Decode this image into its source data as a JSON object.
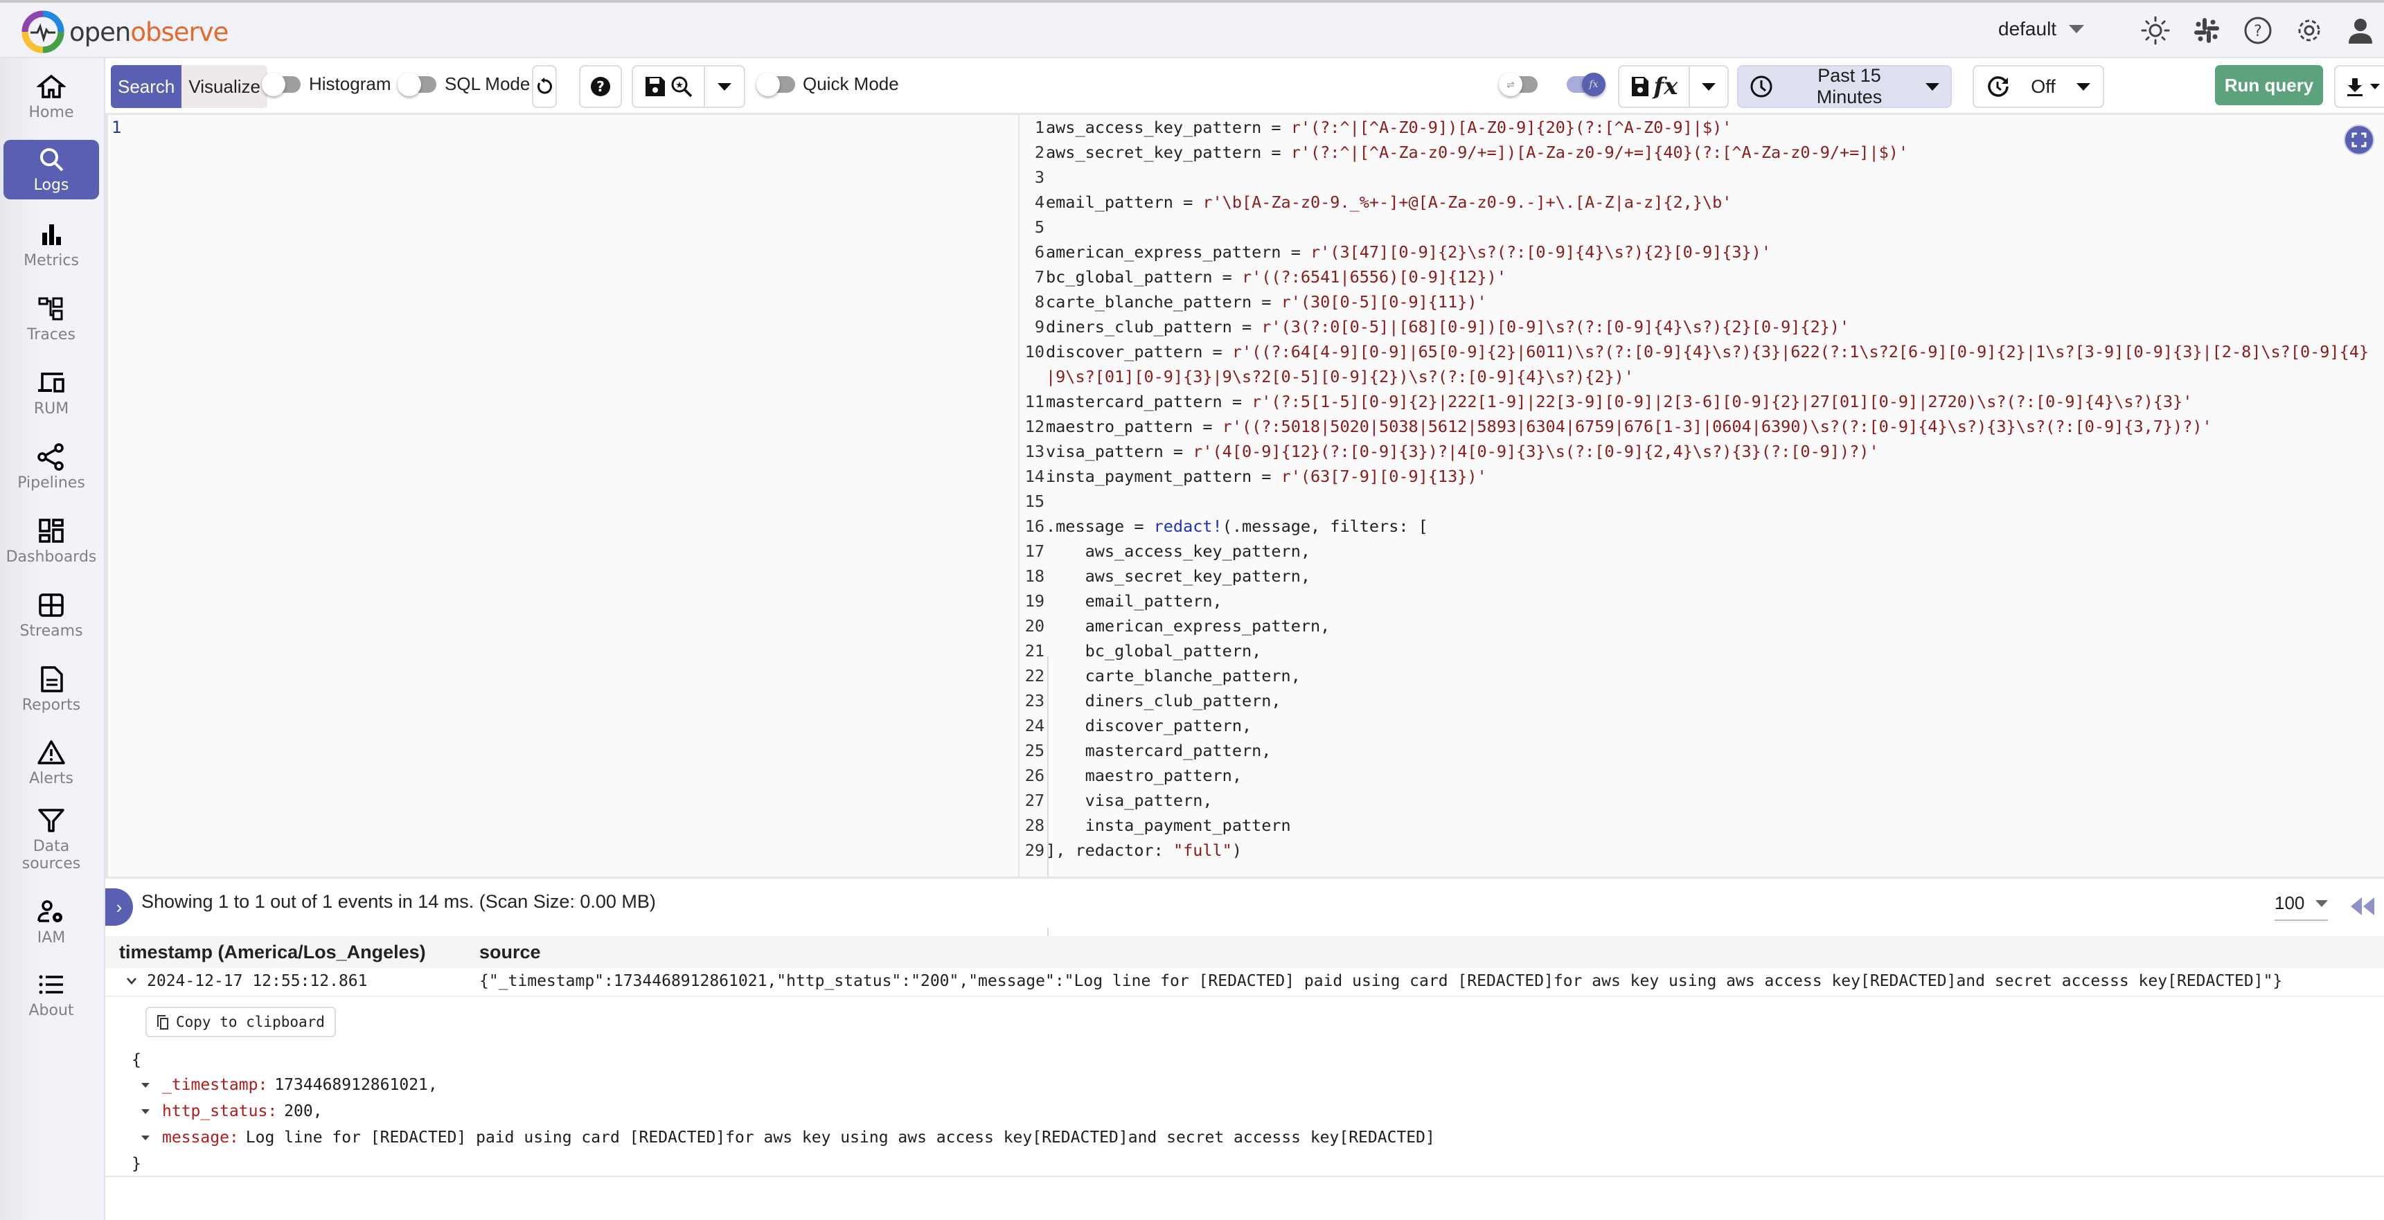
{
  "header": {
    "logo_part1": "open",
    "logo_part2": "observe",
    "org_selector": "default",
    "icons": [
      "theme-toggle-icon",
      "slack-icon",
      "help-icon",
      "settings-icon",
      "user-icon"
    ]
  },
  "sidebar": {
    "items": [
      {
        "label": "Home",
        "icon": "home-icon",
        "active": false
      },
      {
        "label": "Logs",
        "icon": "search-icon",
        "active": true
      },
      {
        "label": "Metrics",
        "icon": "bar-chart-icon",
        "active": false
      },
      {
        "label": "Traces",
        "icon": "traces-icon",
        "active": false
      },
      {
        "label": "RUM",
        "icon": "devices-icon",
        "active": false
      },
      {
        "label": "Pipelines",
        "icon": "share-nodes-icon",
        "active": false
      },
      {
        "label": "Dashboards",
        "icon": "dashboard-icon",
        "active": false
      },
      {
        "label": "Streams",
        "icon": "grid-icon",
        "active": false
      },
      {
        "label": "Reports",
        "icon": "document-icon",
        "active": false
      },
      {
        "label": "Alerts",
        "icon": "warning-icon",
        "active": false
      },
      {
        "label": "Data sources",
        "icon": "filter-icon",
        "active": false
      },
      {
        "label": "IAM",
        "icon": "user-settings-icon",
        "active": false
      },
      {
        "label": "About",
        "icon": "list-icon",
        "active": false
      }
    ]
  },
  "toolbar": {
    "search_tab": "Search",
    "visualize_tab": "Visualize",
    "histogram_label": "Histogram",
    "histogram_on": false,
    "sql_mode_label": "SQL Mode",
    "sql_mode_on": false,
    "quick_mode_label": "Quick Mode",
    "quick_mode_on": false,
    "wrap_toggle_on": false,
    "fx_toggle_on": true,
    "fx_label": "fx",
    "time_range": "Past 15 Minutes",
    "refresh_interval": "Off",
    "run_query_label": "Run query"
  },
  "query_editor": {
    "line_numbers": [
      "1"
    ],
    "content": ""
  },
  "vrl_editor": {
    "lines": [
      {
        "n": "1",
        "text": "aws_access_key_pattern = ",
        "str": "r'(?:^|[^A-Z0-9])[A-Z0-9]{20}(?:[^A-Z0-9]|$)'"
      },
      {
        "n": "2",
        "text": "aws_secret_key_pattern = ",
        "str": "r'(?:^|[^A-Za-z0-9/+=])[A-Za-z0-9/+=]{40}(?:[^A-Za-z0-9/+=]|$)'"
      },
      {
        "n": "3",
        "text": "",
        "str": ""
      },
      {
        "n": "4",
        "text": "email_pattern = ",
        "str": "r'\\b[A-Za-z0-9._%+-]+@[A-Za-z0-9.-]+\\.[A-Z|a-z]{2,}\\b'"
      },
      {
        "n": "5",
        "text": "",
        "str": ""
      },
      {
        "n": "6",
        "text": "american_express_pattern = ",
        "str": "r'(3[47][0-9]{2}\\s?(?:[0-9]{4}\\s?){2}[0-9]{3})'"
      },
      {
        "n": "7",
        "text": "bc_global_pattern = ",
        "str": "r'((?:6541|6556)[0-9]{12})'"
      },
      {
        "n": "8",
        "text": "carte_blanche_pattern = ",
        "str": "r'(30[0-5][0-9]{11})'"
      },
      {
        "n": "9",
        "text": "diners_club_pattern = ",
        "str": "r'(3(?:0[0-5]|[68][0-9])[0-9]\\s?(?:[0-9]{4}\\s?){2}[0-9]{2})'"
      },
      {
        "n": "10",
        "text": "discover_pattern = ",
        "str": "r'((?:64[4-9][0-9]|65[0-9]{2}|6011)\\s?(?:[0-9]{4}\\s?){3}|622(?:1\\s?2[6-9][0-9]{2}|1\\s?[3-9][0-9]{3}|[2-8]\\s?[0-9]{4}|9\\s?[01][0-9]{3}|9\\s?2[0-5][0-9]{2})\\s?(?:[0-9]{4}\\s?){2})'"
      },
      {
        "n": "11",
        "text": "mastercard_pattern = ",
        "str": "r'(?:5[1-5][0-9]{2}|222[1-9]|22[3-9][0-9]|2[3-6][0-9]{2}|27[01][0-9]|2720)\\s?(?:[0-9]{4}\\s?){3}'"
      },
      {
        "n": "12",
        "text": "maestro_pattern = ",
        "str": "r'((?:5018|5020|5038|5612|5893|6304|6759|676[1-3]|0604|6390)\\s?(?:[0-9]{4}\\s?){3}\\s?(?:[0-9]{3,7})?)'"
      },
      {
        "n": "13",
        "text": "visa_pattern = ",
        "str": "r'(4[0-9]{12}(?:[0-9]{3})?|4[0-9]{3}\\s(?:[0-9]{2,4}\\s?){3}(?:[0-9])?)'"
      },
      {
        "n": "14",
        "text": "insta_payment_pattern = ",
        "str": "r'(63[7-9][0-9]{13})'"
      },
      {
        "n": "15",
        "text": "",
        "str": ""
      },
      {
        "n": "16",
        "text": ".message = ",
        "fn": "redact!",
        "rest": "(.message, filters: ["
      },
      {
        "n": "17",
        "text": "    aws_access_key_pattern,"
      },
      {
        "n": "18",
        "text": "    aws_secret_key_pattern,"
      },
      {
        "n": "19",
        "text": "    email_pattern,"
      },
      {
        "n": "20",
        "text": "    american_express_pattern,"
      },
      {
        "n": "21",
        "text": "    bc_global_pattern,"
      },
      {
        "n": "22",
        "text": "    carte_blanche_pattern,"
      },
      {
        "n": "23",
        "text": "    diners_club_pattern,"
      },
      {
        "n": "24",
        "text": "    discover_pattern,"
      },
      {
        "n": "25",
        "text": "    mastercard_pattern,"
      },
      {
        "n": "26",
        "text": "    maestro_pattern,"
      },
      {
        "n": "27",
        "text": "    visa_pattern,"
      },
      {
        "n": "28",
        "text": "    insta_payment_pattern"
      },
      {
        "n": "29",
        "text": "], redactor: ",
        "str": "\"full\"",
        "rest": ")"
      }
    ]
  },
  "results": {
    "summary": "Showing 1 to 1 out of 1 events in 14 ms. (Scan Size: 0.00 MB)",
    "per_page": "100",
    "current_page": "1",
    "columns": [
      "timestamp (America/Los_Angeles)",
      "source"
    ],
    "rows": [
      {
        "timestamp": "2024-12-17 12:55:12.861",
        "source": "{\"_timestamp\":1734468912861021,\"http_status\":\"200\",\"message\":\"Log line for [REDACTED] paid using card [REDACTED]for aws key using aws access key[REDACTED]and secret accesss key[REDACTED]\"}"
      }
    ],
    "expanded": {
      "copy_label": "Copy to clipboard",
      "open_brace": "{",
      "close_brace": "}",
      "fields": [
        {
          "key": "_timestamp:",
          "value": "1734468912861021,"
        },
        {
          "key": "http_status:",
          "value": "200,"
        },
        {
          "key": "message:",
          "value": "Log line for [REDACTED] paid using card [REDACTED]for aws key using aws access key[REDACTED]and secret accesss key[REDACTED]"
        }
      ]
    }
  },
  "colors": {
    "accent": "#5960b2",
    "run_button": "#5ba27d",
    "string": "#8b1a1a",
    "function": "#1f2fbf",
    "json_key": "#b01b1b"
  }
}
